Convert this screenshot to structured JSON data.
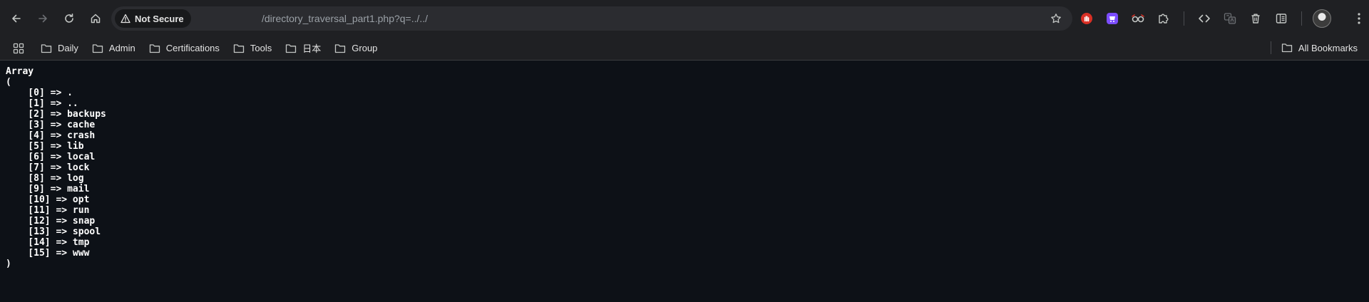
{
  "browser": {
    "security_label": "Not Secure",
    "url": "/directory_traversal_part1.php?q=../../",
    "nav_icons": [
      "back-arrow-icon",
      "forward-arrow-icon",
      "reload-icon",
      "home-icon"
    ],
    "extension_icons": [
      "hand-extension-icon",
      "purple-extension-icon",
      "glasses-extension-icon",
      "puzzle-icon",
      "code-icon",
      "translate-icon",
      "trash-icon",
      "reading-list-icon"
    ],
    "colors": {
      "toolbar": "#1f2023",
      "omnibox": "#2b2c30",
      "page_background": "#0d1117",
      "text": "#e3e3e3"
    }
  },
  "bookmarks": {
    "items": [
      {
        "label": "Daily"
      },
      {
        "label": "Admin"
      },
      {
        "label": "Certifications"
      },
      {
        "label": "Tools"
      },
      {
        "label": "日本"
      },
      {
        "label": "Group"
      }
    ],
    "all_label": "All Bookmarks"
  },
  "page": {
    "output": "Array\n(\n    [0] => .\n    [1] => ..\n    [2] => backups\n    [3] => cache\n    [4] => crash\n    [5] => lib\n    [6] => local\n    [7] => lock\n    [8] => log\n    [9] => mail\n    [10] => opt\n    [11] => run\n    [12] => snap\n    [13] => spool\n    [14] => tmp\n    [15] => www\n)"
  }
}
